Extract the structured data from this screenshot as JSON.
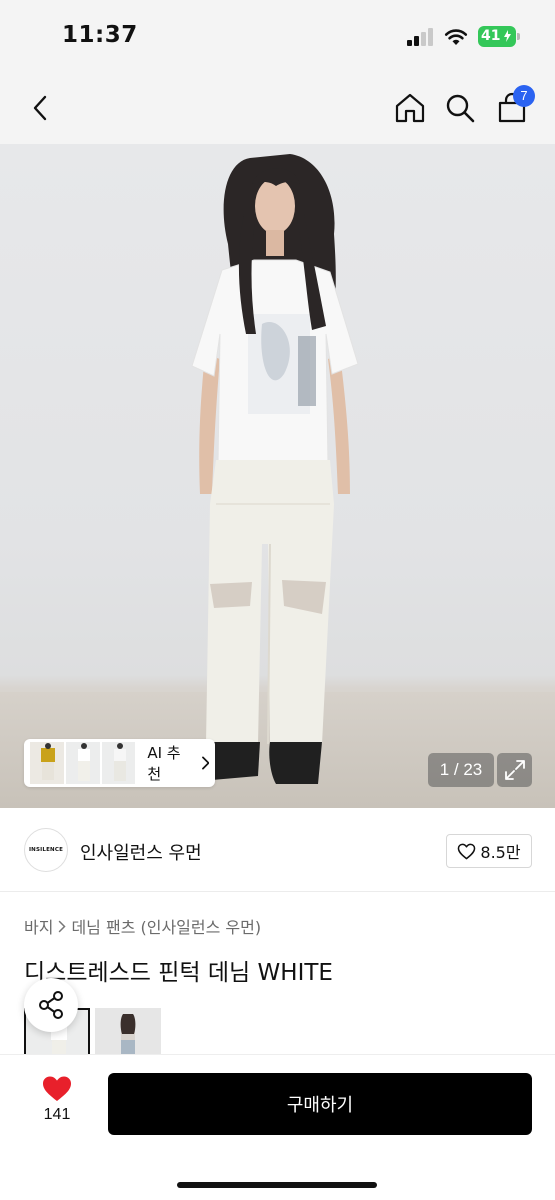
{
  "status_bar": {
    "time": "11:37",
    "battery": "41",
    "icons": [
      "signal-icon",
      "wifi-icon",
      "battery-icon"
    ]
  },
  "nav": {
    "icons": [
      "back-icon",
      "home-icon",
      "search-icon",
      "cart-icon"
    ],
    "cart_badge": "7"
  },
  "hero": {
    "ai_label": "AI 추천",
    "page_counter": "1 / 23",
    "icons": [
      "chevron-right-icon",
      "expand-icon"
    ]
  },
  "brand": {
    "logo_text": "INSILENCE",
    "name": "인사일런스 우먼",
    "like_count": "8.5만",
    "icons": [
      "heart-outline-icon"
    ]
  },
  "breadcrumb": {
    "items": [
      "바지",
      "데님 팬츠 (인사일런스 우먼)"
    ]
  },
  "product": {
    "title": "디스트레스드 핀턱 데님 WHITE"
  },
  "bottom_bar": {
    "wish_count": "141",
    "buy_label": "구매하기",
    "icons": [
      "heart-filled-icon",
      "share-icon"
    ]
  },
  "colors": {
    "accent_blue": "#2b63f1",
    "battery_green": "#34c759",
    "heart_red": "#e8202b",
    "buy_button": "#000000"
  }
}
